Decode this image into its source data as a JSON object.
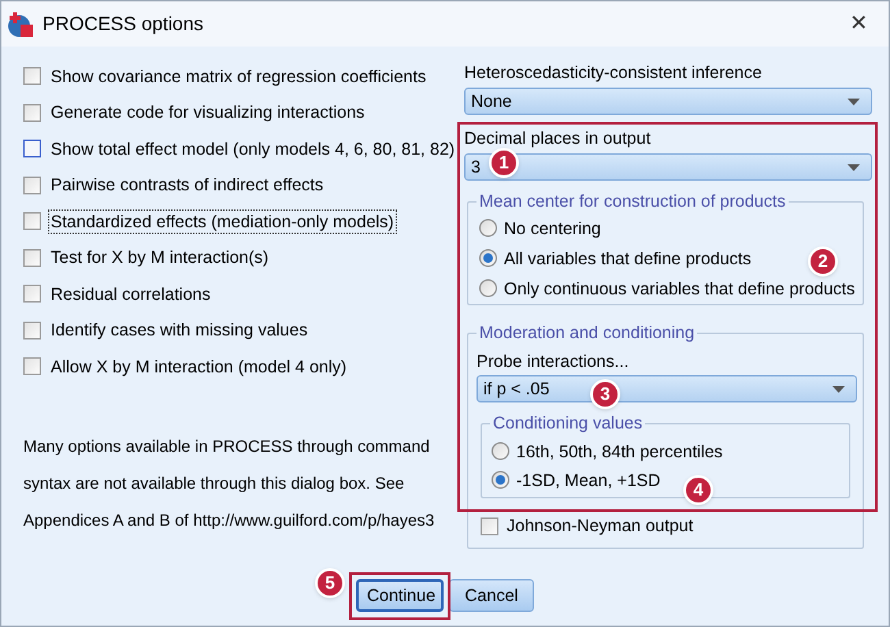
{
  "window": {
    "title": "PROCESS options",
    "close": "✕"
  },
  "options": [
    {
      "label": "Show covariance matrix of regression coefficients",
      "checked": false,
      "hovered": false,
      "focused": false
    },
    {
      "label": "Generate code for visualizing interactions",
      "checked": false,
      "hovered": false,
      "focused": false
    },
    {
      "label": "Show total effect model (only models 4, 6, 80, 81, 82)",
      "checked": false,
      "hovered": true,
      "focused": false
    },
    {
      "label": "Pairwise contrasts of indirect effects",
      "checked": false,
      "hovered": false,
      "focused": false
    },
    {
      "label": "Standardized effects (mediation-only models)",
      "checked": false,
      "hovered": false,
      "focused": true
    },
    {
      "label": "Test for X by M interaction(s)",
      "checked": false,
      "hovered": false,
      "focused": false
    },
    {
      "label": "Residual correlations",
      "checked": false,
      "hovered": false,
      "focused": false
    },
    {
      "label": "Identify cases with missing values",
      "checked": false,
      "hovered": false,
      "focused": false
    },
    {
      "label": "Allow X by M interaction (model 4 only)",
      "checked": false,
      "hovered": false,
      "focused": false
    }
  ],
  "note": {
    "lines": [
      "Many options available in PROCESS through command",
      "syntax are not available through this dialog box.  See",
      "Appendices A and B of http://www.guilford.com/p/hayes3"
    ]
  },
  "hc_inference": {
    "label": "Heteroscedasticity-consistent inference",
    "value": "None"
  },
  "decimal_places": {
    "label": "Decimal places in output",
    "value": "3"
  },
  "mean_center": {
    "title": "Mean center for construction of products",
    "options": [
      {
        "label": "No centering",
        "selected": false
      },
      {
        "label": "All variables that define products",
        "selected": true
      },
      {
        "label": "Only continuous variables that define products",
        "selected": false
      }
    ]
  },
  "moderation": {
    "title": "Moderation and conditioning",
    "probe": {
      "label": "Probe interactions...",
      "value": "if p <  .05"
    },
    "conditioning": {
      "title": "Conditioning values",
      "options": [
        {
          "label": "16th, 50th, 84th percentiles",
          "selected": false
        },
        {
          "label": "-1SD, Mean, +1SD",
          "selected": true
        }
      ]
    },
    "johnson_neyman": {
      "label": "Johnson-Neyman output",
      "checked": false
    }
  },
  "buttons": [
    {
      "label": "Continue",
      "default": true
    },
    {
      "label": "Cancel",
      "default": false
    }
  ],
  "annotations": [
    {
      "number": "1"
    },
    {
      "number": "2"
    },
    {
      "number": "3"
    },
    {
      "number": "4"
    },
    {
      "number": "5"
    }
  ]
}
